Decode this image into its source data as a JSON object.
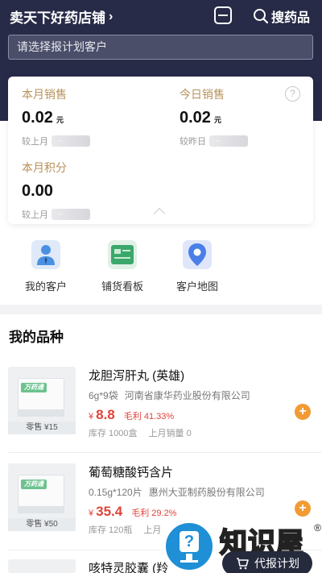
{
  "header": {
    "shop_name": "卖天下好药店铺",
    "search_label": "搜药品"
  },
  "customer_select": {
    "placeholder": "请选择报计划客户"
  },
  "stats": {
    "month_sales": {
      "label": "本月销售",
      "value": "0.02",
      "unit": "元",
      "compare_label": "较上月",
      "compare_value": "--"
    },
    "today_sales": {
      "label": "今日销售",
      "value": "0.02",
      "unit": "元",
      "compare_label": "较昨日",
      "compare_value": "--"
    },
    "month_points": {
      "label": "本月积分",
      "value": "0.00",
      "compare_label": "较上月",
      "compare_value": "--"
    }
  },
  "shortcuts": [
    {
      "label": "我的客户",
      "icon": "customer-icon",
      "color": "#4a90e2"
    },
    {
      "label": "铺货看板",
      "icon": "board-icon",
      "color": "#3aa86b"
    },
    {
      "label": "客户地图",
      "icon": "map-pin-icon",
      "color": "#4a7fe8"
    }
  ],
  "section_title": "我的品种",
  "products": [
    {
      "name": "龙胆泻肝丸 (英雄)",
      "spec": "6g*9袋",
      "manufacturer": "河南省康华药业股份有限公司",
      "retail": "零售 ¥15",
      "currency": "¥",
      "price": "8.8",
      "margin": "毛利 41.33%",
      "stock": "库存  1000盒",
      "last_month_sales": "上月销量 0",
      "box_brand": "万药通"
    },
    {
      "name": "葡萄糖酸钙含片",
      "spec": "0.15g*120片",
      "manufacturer": "惠州大亚制药股份有限公司",
      "retail": "零售 ¥50",
      "currency": "¥",
      "price": "35.4",
      "margin": "毛利 29.2%",
      "stock": "库存  120瓶",
      "last_month_sales": "上月",
      "box_brand": "万药通"
    },
    {
      "name": "咳特灵胶囊 (羚"
    }
  ],
  "watermark": {
    "text": "知识屋",
    "reg": "®"
  },
  "plan_button": {
    "label": "代报计划"
  },
  "colors": {
    "header_bg": "#272b47",
    "accent_gold": "#b8925a",
    "price_red": "#e0443a",
    "add_orange": "#f29b34"
  }
}
